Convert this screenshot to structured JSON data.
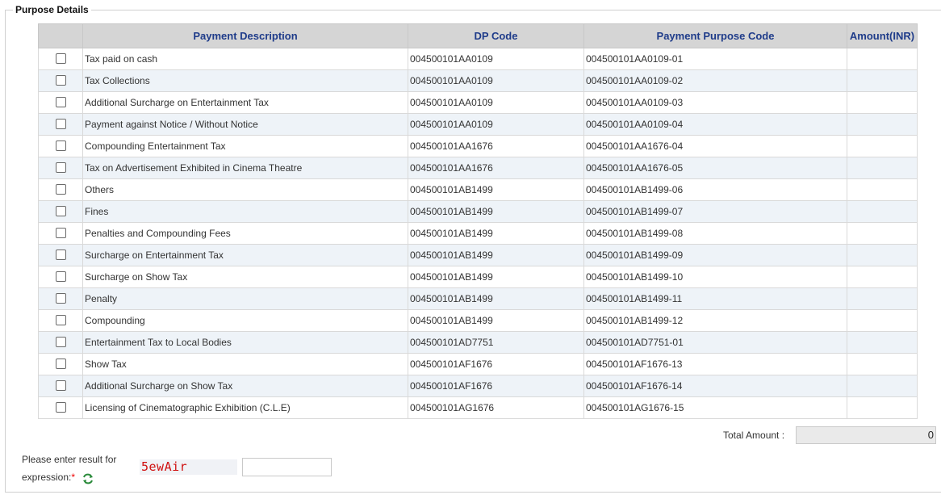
{
  "section": {
    "legend": "Purpose Details"
  },
  "table": {
    "headers": [
      "",
      "Payment Description",
      "DP Code",
      "Payment Purpose Code",
      "Amount(INR)"
    ],
    "rows": [
      {
        "description": "Tax paid on cash",
        "dp_code": "004500101AA0109",
        "purpose_code": "004500101AA0109-01",
        "amount": "",
        "checked": false
      },
      {
        "description": "Tax Collections",
        "dp_code": "004500101AA0109",
        "purpose_code": "004500101AA0109-02",
        "amount": "",
        "checked": false
      },
      {
        "description": "Additional Surcharge on Entertainment Tax",
        "dp_code": "004500101AA0109",
        "purpose_code": "004500101AA0109-03",
        "amount": "",
        "checked": false
      },
      {
        "description": "Payment against Notice / Without Notice",
        "dp_code": "004500101AA0109",
        "purpose_code": "004500101AA0109-04",
        "amount": "",
        "checked": false
      },
      {
        "description": "Compounding Entertainment Tax",
        "dp_code": "004500101AA1676",
        "purpose_code": "004500101AA1676-04",
        "amount": "",
        "checked": false
      },
      {
        "description": "Tax on Advertisement Exhibited in Cinema Theatre",
        "dp_code": "004500101AA1676",
        "purpose_code": "004500101AA1676-05",
        "amount": "",
        "checked": false
      },
      {
        "description": "Others",
        "dp_code": "004500101AB1499",
        "purpose_code": "004500101AB1499-06",
        "amount": "",
        "checked": false
      },
      {
        "description": "Fines",
        "dp_code": "004500101AB1499",
        "purpose_code": "004500101AB1499-07",
        "amount": "",
        "checked": false
      },
      {
        "description": "Penalties and Compounding Fees",
        "dp_code": "004500101AB1499",
        "purpose_code": "004500101AB1499-08",
        "amount": "",
        "checked": false
      },
      {
        "description": "Surcharge on Entertainment Tax",
        "dp_code": "004500101AB1499",
        "purpose_code": "004500101AB1499-09",
        "amount": "",
        "checked": false
      },
      {
        "description": "Surcharge on Show Tax",
        "dp_code": "004500101AB1499",
        "purpose_code": "004500101AB1499-10",
        "amount": "",
        "checked": false
      },
      {
        "description": "Penalty",
        "dp_code": "004500101AB1499",
        "purpose_code": "004500101AB1499-11",
        "amount": "",
        "checked": false
      },
      {
        "description": "Compounding",
        "dp_code": "004500101AB1499",
        "purpose_code": "004500101AB1499-12",
        "amount": "",
        "checked": false
      },
      {
        "description": "Entertainment Tax to Local Bodies",
        "dp_code": "004500101AD7751",
        "purpose_code": "004500101AD7751-01",
        "amount": "",
        "checked": false
      },
      {
        "description": "Show Tax",
        "dp_code": "004500101AF1676",
        "purpose_code": "004500101AF1676-13",
        "amount": "",
        "checked": false
      },
      {
        "description": "Additional Surcharge on Show Tax",
        "dp_code": "004500101AF1676",
        "purpose_code": "004500101AF1676-14",
        "amount": "",
        "checked": false
      },
      {
        "description": "Licensing of Cinematographic Exhibition (C.L.E)",
        "dp_code": "004500101AG1676",
        "purpose_code": "004500101AG1676-15",
        "amount": "",
        "checked": false
      }
    ]
  },
  "total": {
    "label": "Total Amount :",
    "value": "0"
  },
  "captcha": {
    "label_line1": "Please enter result for",
    "label_line2": "expression:",
    "required_mark": "*",
    "refresh_icon": "refresh-arrows-icon",
    "image_text": "5ewAir",
    "input_value": ""
  },
  "colors": {
    "header_bg": "#d5d5d5",
    "header_text": "#1f3c8a",
    "alt_row_bg": "#eef3f8",
    "captcha_text": "#d01010",
    "refresh_icon": "#2a8a3a"
  }
}
